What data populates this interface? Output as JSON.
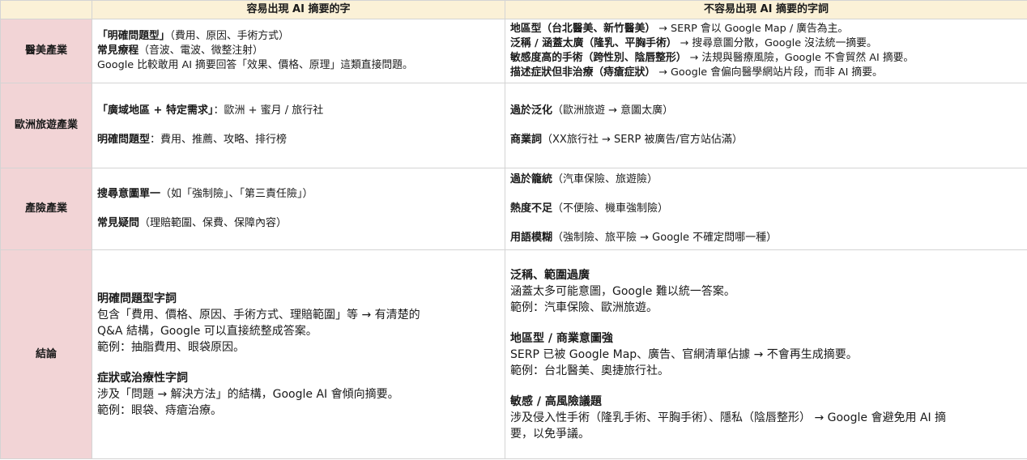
{
  "header": {
    "col1": "容易出現 AI 摘要的字",
    "col2": "不容易出現 AI 摘要的字詞"
  },
  "rows": [
    {
      "label": "醫美產業",
      "left": [
        {
          "bold": "「明確問題型」",
          "rest": "（費用、原因、手術方式）"
        },
        {
          "bold": "常見療程",
          "rest": "（音波、電波、微整注射）"
        },
        {
          "bold": "",
          "rest": "Google 比較敢用 AI 摘要回答「效果、價格、原理」這類直接問題。"
        }
      ],
      "right": [
        {
          "bold": "地區型（台北醫美、新竹醫美）",
          "rest": " → SERP 會以 Google Map / 廣告為主。"
        },
        {
          "bold": "泛稱 / 涵蓋太廣（隆乳、平胸手術）",
          "rest": " → 搜尋意圖分散，Google 沒法統一摘要。"
        },
        {
          "bold": "敏感度高的手術（跨性別、陰唇整形）",
          "rest": " → 法規與醫療風險，Google 不會貿然 AI 摘要。"
        },
        {
          "bold": "描述症狀但非治療（痔瘡症狀）",
          "rest": " → Google 會偏向醫學網站片段，而非 AI 摘要。"
        }
      ]
    },
    {
      "label": "歐洲旅遊產業",
      "left": [
        {
          "bold": "「廣域地區 + 特定需求」",
          "rest": "：歐洲 + 蜜月 / 旅行社"
        },
        {
          "gap": true
        },
        {
          "bold": "明確問題型",
          "rest": "：費用、推薦、攻略、排行榜"
        }
      ],
      "right": [
        {
          "bold": "過於泛化",
          "rest": "（歐洲旅遊 → 意圖太廣）"
        },
        {
          "gap": true
        },
        {
          "bold": "商業詞",
          "rest": "（XX旅行社 → SERP 被廣告/官方站佔滿）"
        }
      ]
    },
    {
      "label": "產險產業",
      "left": [
        {
          "bold": "搜尋意圖單一",
          "rest": "（如「強制險」、「第三責任險」）"
        },
        {
          "gap": true
        },
        {
          "bold": "常見疑問",
          "rest": "（理賠範圍、保費、保障內容）"
        }
      ],
      "right": [
        {
          "bold": "過於籠統",
          "rest": "（汽車保險、旅遊險）"
        },
        {
          "gap": true
        },
        {
          "bold": "熱度不足",
          "rest": "（不便險、機車強制險）"
        },
        {
          "gap": true
        },
        {
          "bold": "用語模糊",
          "rest": "（強制險、旅平險 → Google 不確定問哪一種）"
        }
      ]
    },
    {
      "label": "結論",
      "left": [
        {
          "bold": "明確問題型字詞",
          "rest": ""
        },
        {
          "bold": "",
          "rest": "包含「費用、價格、原因、手術方式、理賠範圍」等 → 有清楚的"
        },
        {
          "bold": "",
          "rest": "Q&A 結構，Google 可以直接統整成答案。"
        },
        {
          "bold": "",
          "rest": "範例：抽脂費用、眼袋原因。"
        },
        {
          "gap": true
        },
        {
          "bold": "症狀或治療性字詞",
          "rest": ""
        },
        {
          "bold": "",
          "rest": "涉及「問題 → 解決方法」的結構，Google AI 會傾向摘要。"
        },
        {
          "bold": "",
          "rest": "範例：眼袋、痔瘡治療。"
        }
      ],
      "right": [
        {
          "bold": "泛稱、範圍過廣",
          "rest": ""
        },
        {
          "bold": "",
          "rest": "涵蓋太多可能意圖，Google 難以統一答案。"
        },
        {
          "bold": "",
          "rest": "範例：汽車保險、歐洲旅遊。"
        },
        {
          "gap": true
        },
        {
          "bold": "地區型 / 商業意圖強",
          "rest": ""
        },
        {
          "bold": "",
          "rest": "SERP 已被 Google Map、廣告、官網清單佔據 → 不會再生成摘要。"
        },
        {
          "bold": "",
          "rest": "範例：台北醫美、奧捷旅行社。"
        },
        {
          "gap": true
        },
        {
          "bold": "敏感 / 高風險議題",
          "rest": ""
        },
        {
          "bold": "",
          "rest": "涉及侵入性手術（隆乳手術、平胸手術）、隱私（陰唇整形） → Google 會避免用 AI 摘"
        },
        {
          "bold": "",
          "rest": "要，以免爭議。"
        }
      ]
    }
  ]
}
